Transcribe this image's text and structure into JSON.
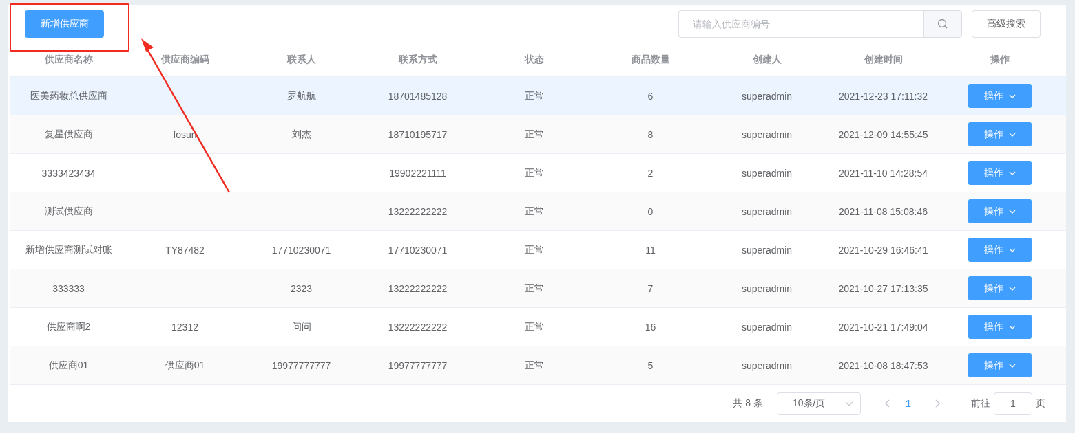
{
  "toolbar": {
    "add_button": "新增供应商",
    "search": {
      "placeholder": "请输入供应商编号"
    },
    "advanced_button": "高级搜索"
  },
  "table": {
    "columns": [
      "供应商名称",
      "供应商编码",
      "联系人",
      "联系方式",
      "状态",
      "商品数量",
      "创建人",
      "创建时间",
      "操作"
    ],
    "rows": [
      {
        "selected": true,
        "cells": [
          "医美药妆总供应商",
          "",
          "罗航航",
          "18701485128",
          "正常",
          "6",
          "superadmin",
          "2021-12-23 17:11:32"
        ],
        "action": "操作"
      },
      {
        "selected": false,
        "cells": [
          "复星供应商",
          "fosun",
          "刘杰",
          "18710195717",
          "正常",
          "8",
          "superadmin",
          "2021-12-09 14:55:45"
        ],
        "action": "操作"
      },
      {
        "selected": false,
        "cells": [
          "3333423434",
          "",
          "",
          "19902221111",
          "正常",
          "2",
          "superadmin",
          "2021-11-10 14:28:54"
        ],
        "action": "操作"
      },
      {
        "selected": false,
        "cells": [
          "测试供应商",
          "",
          "",
          "13222222222",
          "正常",
          "0",
          "superadmin",
          "2021-11-08 15:08:46"
        ],
        "action": "操作"
      },
      {
        "selected": false,
        "cells": [
          "新增供应商测试对账",
          "TY87482",
          "17710230071",
          "17710230071",
          "正常",
          "11",
          "superadmin",
          "2021-10-29 16:46:41"
        ],
        "action": "操作"
      },
      {
        "selected": false,
        "cells": [
          "333333",
          "",
          "2323",
          "13222222222",
          "正常",
          "7",
          "superadmin",
          "2021-10-27 17:13:35"
        ],
        "action": "操作"
      },
      {
        "selected": false,
        "cells": [
          "供应商啊2",
          "12312",
          "问问",
          "13222222222",
          "正常",
          "16",
          "superadmin",
          "2021-10-21 17:49:04"
        ],
        "action": "操作"
      },
      {
        "selected": false,
        "cells": [
          "供应商01",
          "供应商01",
          "19977777777",
          "19977777777",
          "正常",
          "5",
          "superadmin",
          "2021-10-08 18:47:53"
        ],
        "action": "操作"
      }
    ]
  },
  "pagination": {
    "total": "共 8 条",
    "page_size": "10条/页",
    "pages": [
      {
        "label": "1",
        "selected": true
      }
    ],
    "goto_label": "前往",
    "goto_value": "1",
    "goto_suffix": "页"
  }
}
